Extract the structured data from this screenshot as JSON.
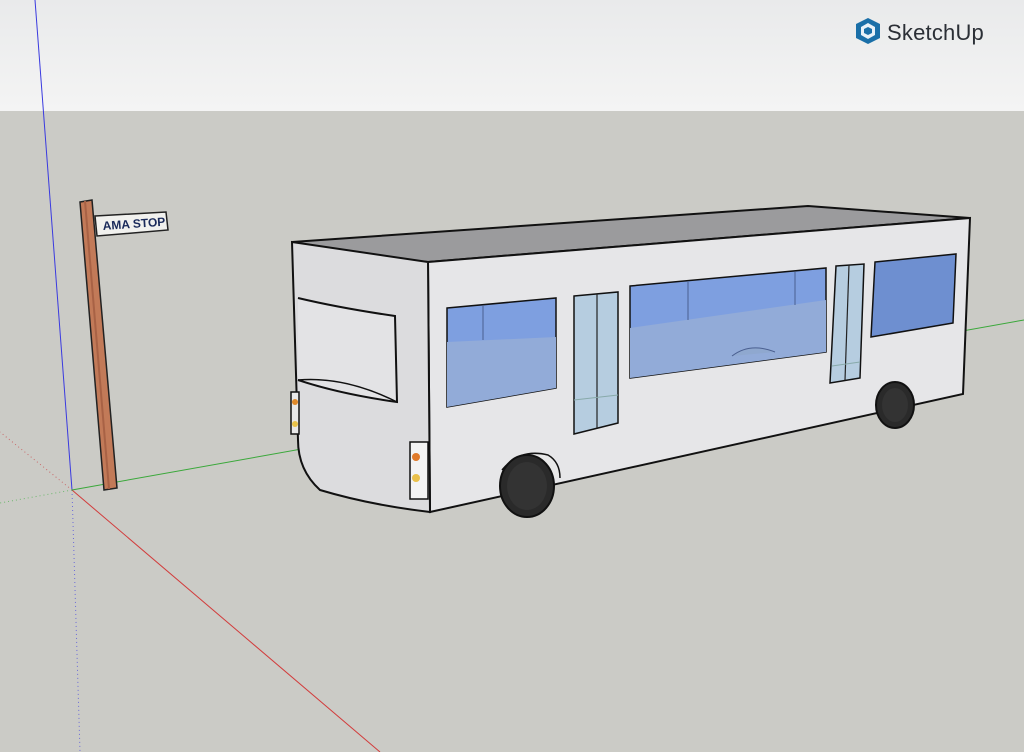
{
  "app": {
    "logo_text": "SketchUp",
    "logo_icon": "sketchup-logo-icon"
  },
  "model": {
    "sign_text": "AMA STOP"
  },
  "colors": {
    "sky": "#f1f1f1",
    "ground": "#cbcbc6",
    "bus_body": "#e6e6e8",
    "bus_roof": "#9a9a9c",
    "glass": "#7fa3e0",
    "pole": "#c27a58",
    "axis_red": "#d23c3c",
    "axis_green": "#3aa83a",
    "axis_blue": "#3a3ae0"
  }
}
